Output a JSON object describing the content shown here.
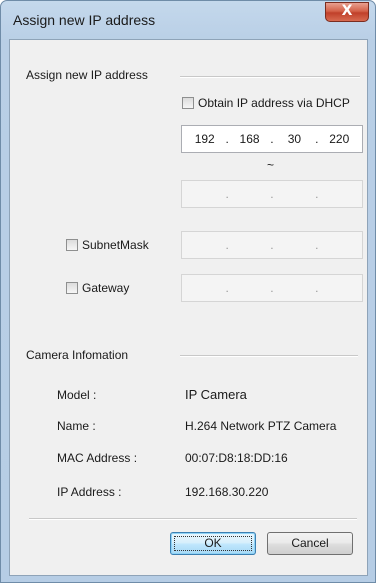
{
  "window": {
    "title": "Assign new IP address",
    "close_label": "X"
  },
  "assign_group": {
    "label": "Assign new IP address",
    "dhcp_label": "Obtain IP address via DHCP",
    "start_ip": [
      "192",
      "168",
      "30",
      "220"
    ],
    "range_separator": "~",
    "end_ip_dots": ".",
    "subnet_label": "SubnetMask",
    "gateway_label": "Gateway"
  },
  "camera_group": {
    "label": "Camera Infomation",
    "model_label": "Model :",
    "model_value": "IP Camera",
    "name_label": "Name :",
    "name_value": "H.264 Network PTZ Camera",
    "mac_label": "MAC Address :",
    "mac_value": "00:07:D8:18:DD:16",
    "ip_label": "IP Address :",
    "ip_value": "192.168.30.220"
  },
  "buttons": {
    "ok": "OK",
    "cancel": "Cancel"
  },
  "colors": {
    "title_bar": "#b9cfe6",
    "close_button": "#c0402a",
    "dialog_bg": "#f0f0f0"
  }
}
